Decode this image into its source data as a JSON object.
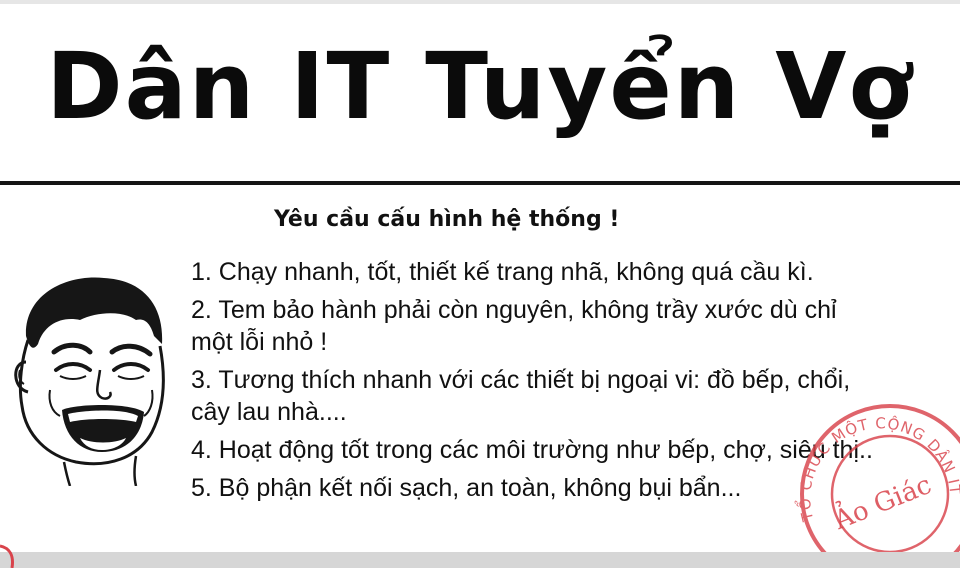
{
  "header": {
    "title": "Dân IT Tuyển Vợ"
  },
  "main": {
    "subtitle": "Yêu cầu cấu hình hệ thống !",
    "requirements": [
      {
        "line1": "1. Chạy nhanh, tốt, thiết kế trang nhã, không quá cầu kì.",
        "line2": ""
      },
      {
        "line1": "2. Tem bảo hành phải còn nguyên, không trầy xước dù chỉ",
        "line2": "một lỗi nhỏ !"
      },
      {
        "line1": "3. Tương thích nhanh với các thiết bị ngoại vi: đồ bếp, chổi,",
        "line2": "cây lau nhà...."
      },
      {
        "line1": "4. Hoạt động tốt trong các môi trường như bếp, chợ, siêu thị..",
        "line2": ""
      },
      {
        "line1": "5. Bộ phận kết nối sạch, an toàn, không bụi bẩn...",
        "line2": ""
      }
    ]
  },
  "stamp": {
    "ring_text": "TỔ CHỨC MỘT CỘNG DÂN IT ĐA",
    "center_text": "Ảo Giác",
    "color": "#d9434b"
  },
  "icons": {
    "face": "laughing-meme-face-icon",
    "stamp": "red-stamp-seal"
  }
}
